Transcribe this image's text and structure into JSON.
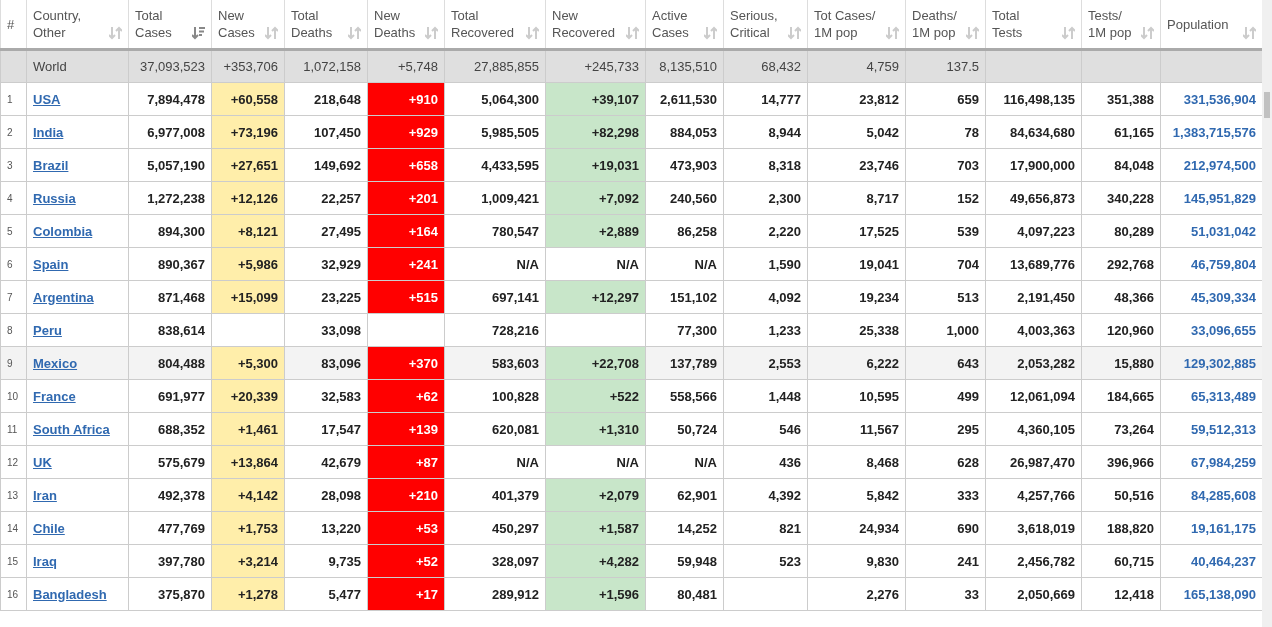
{
  "table": {
    "columns": [
      {
        "kind": "rank",
        "lines": [
          "#"
        ]
      },
      {
        "kind": "link",
        "lines": [
          "Country,",
          "Other"
        ],
        "sorted": false
      },
      {
        "kind": "number",
        "lines": [
          "Total",
          "Cases"
        ],
        "sorted": true
      },
      {
        "kind": "new_cases",
        "lines": [
          "New",
          "Cases"
        ],
        "sorted": false
      },
      {
        "kind": "number",
        "lines": [
          "Total",
          "Deaths"
        ],
        "sorted": false
      },
      {
        "kind": "new_deaths",
        "lines": [
          "New",
          "Deaths"
        ],
        "sorted": false
      },
      {
        "kind": "number",
        "lines": [
          "Total",
          "Recovered"
        ],
        "sorted": false
      },
      {
        "kind": "new_recovered",
        "lines": [
          "New",
          "Recovered"
        ],
        "sorted": false
      },
      {
        "kind": "number",
        "lines": [
          "Active",
          "Cases"
        ],
        "sorted": false
      },
      {
        "kind": "number",
        "lines": [
          "Serious,",
          "Critical"
        ],
        "sorted": false
      },
      {
        "kind": "number",
        "lines": [
          "Tot Cases/",
          "1M pop"
        ],
        "sorted": false
      },
      {
        "kind": "number",
        "lines": [
          "Deaths/",
          "1M pop"
        ],
        "sorted": false
      },
      {
        "kind": "number",
        "lines": [
          "Total",
          "Tests"
        ],
        "sorted": false
      },
      {
        "kind": "number",
        "lines": [
          "Tests/",
          "1M pop"
        ],
        "sorted": false
      },
      {
        "kind": "population",
        "lines": [
          "Population"
        ],
        "sorted": false
      }
    ],
    "world_row": {
      "country": "World",
      "total_cases": "37,093,523",
      "new_cases": "+353,706",
      "total_deaths": "1,072,158",
      "new_deaths": "+5,748",
      "total_recovered": "27,885,855",
      "new_recovered": "+245,733",
      "active_cases": "8,135,510",
      "serious_critical": "68,432",
      "tot_cases_1m": "4,759",
      "deaths_1m": "137.5"
    },
    "rows": [
      {
        "highlighted": false,
        "recovered_reported": true,
        "rank": "1",
        "country": "USA",
        "total_cases": "7,894,478",
        "new_cases": "+60,558",
        "total_deaths": "218,648",
        "new_deaths": "+910",
        "total_recovered": "5,064,300",
        "new_recovered": "+39,107",
        "active_cases": "2,611,530",
        "serious_critical": "14,777",
        "tot_cases_1m": "23,812",
        "deaths_1m": "659",
        "total_tests": "116,498,135",
        "tests_1m": "351,388",
        "population": "331,536,904"
      },
      {
        "highlighted": false,
        "recovered_reported": true,
        "rank": "2",
        "country": "India",
        "total_cases": "6,977,008",
        "new_cases": "+73,196",
        "total_deaths": "107,450",
        "new_deaths": "+929",
        "total_recovered": "5,985,505",
        "new_recovered": "+82,298",
        "active_cases": "884,053",
        "serious_critical": "8,944",
        "tot_cases_1m": "5,042",
        "deaths_1m": "78",
        "total_tests": "84,634,680",
        "tests_1m": "61,165",
        "population": "1,383,715,576"
      },
      {
        "highlighted": false,
        "recovered_reported": true,
        "rank": "3",
        "country": "Brazil",
        "total_cases": "5,057,190",
        "new_cases": "+27,651",
        "total_deaths": "149,692",
        "new_deaths": "+658",
        "total_recovered": "4,433,595",
        "new_recovered": "+19,031",
        "active_cases": "473,903",
        "serious_critical": "8,318",
        "tot_cases_1m": "23,746",
        "deaths_1m": "703",
        "total_tests": "17,900,000",
        "tests_1m": "84,048",
        "population": "212,974,500"
      },
      {
        "highlighted": false,
        "recovered_reported": true,
        "rank": "4",
        "country": "Russia",
        "total_cases": "1,272,238",
        "new_cases": "+12,126",
        "total_deaths": "22,257",
        "new_deaths": "+201",
        "total_recovered": "1,009,421",
        "new_recovered": "+7,092",
        "active_cases": "240,560",
        "serious_critical": "2,300",
        "tot_cases_1m": "8,717",
        "deaths_1m": "152",
        "total_tests": "49,656,873",
        "tests_1m": "340,228",
        "population": "145,951,829"
      },
      {
        "highlighted": false,
        "recovered_reported": true,
        "rank": "5",
        "country": "Colombia",
        "total_cases": "894,300",
        "new_cases": "+8,121",
        "total_deaths": "27,495",
        "new_deaths": "+164",
        "total_recovered": "780,547",
        "new_recovered": "+2,889",
        "active_cases": "86,258",
        "serious_critical": "2,220",
        "tot_cases_1m": "17,525",
        "deaths_1m": "539",
        "total_tests": "4,097,223",
        "tests_1m": "80,289",
        "population": "51,031,042"
      },
      {
        "highlighted": false,
        "recovered_reported": false,
        "rank": "6",
        "country": "Spain",
        "total_cases": "890,367",
        "new_cases": "+5,986",
        "total_deaths": "32,929",
        "new_deaths": "+241",
        "total_recovered": "N/A",
        "new_recovered": "N/A",
        "active_cases": "N/A",
        "serious_critical": "1,590",
        "tot_cases_1m": "19,041",
        "deaths_1m": "704",
        "total_tests": "13,689,776",
        "tests_1m": "292,768",
        "population": "46,759,804"
      },
      {
        "highlighted": false,
        "recovered_reported": true,
        "rank": "7",
        "country": "Argentina",
        "total_cases": "871,468",
        "new_cases": "+15,099",
        "total_deaths": "23,225",
        "new_deaths": "+515",
        "total_recovered": "697,141",
        "new_recovered": "+12,297",
        "active_cases": "151,102",
        "serious_critical": "4,092",
        "tot_cases_1m": "19,234",
        "deaths_1m": "513",
        "total_tests": "2,191,450",
        "tests_1m": "48,366",
        "population": "45,309,334"
      },
      {
        "highlighted": false,
        "recovered_reported": false,
        "rank": "8",
        "country": "Peru",
        "total_cases": "838,614",
        "total_deaths": "33,098",
        "total_recovered": "728,216",
        "active_cases": "77,300",
        "serious_critical": "1,233",
        "tot_cases_1m": "25,338",
        "deaths_1m": "1,000",
        "total_tests": "4,003,363",
        "tests_1m": "120,960",
        "population": "33,096,655"
      },
      {
        "highlighted": true,
        "recovered_reported": true,
        "rank": "9",
        "country": "Mexico",
        "total_cases": "804,488",
        "new_cases": "+5,300",
        "total_deaths": "83,096",
        "new_deaths": "+370",
        "total_recovered": "583,603",
        "new_recovered": "+22,708",
        "active_cases": "137,789",
        "serious_critical": "2,553",
        "tot_cases_1m": "6,222",
        "deaths_1m": "643",
        "total_tests": "2,053,282",
        "tests_1m": "15,880",
        "population": "129,302,885"
      },
      {
        "highlighted": false,
        "recovered_reported": true,
        "rank": "10",
        "country": "France",
        "total_cases": "691,977",
        "new_cases": "+20,339",
        "total_deaths": "32,583",
        "new_deaths": "+62",
        "total_recovered": "100,828",
        "new_recovered": "+522",
        "active_cases": "558,566",
        "serious_critical": "1,448",
        "tot_cases_1m": "10,595",
        "deaths_1m": "499",
        "total_tests": "12,061,094",
        "tests_1m": "184,665",
        "population": "65,313,489"
      },
      {
        "highlighted": false,
        "recovered_reported": true,
        "rank": "11",
        "country": "South Africa",
        "total_cases": "688,352",
        "new_cases": "+1,461",
        "total_deaths": "17,547",
        "new_deaths": "+139",
        "total_recovered": "620,081",
        "new_recovered": "+1,310",
        "active_cases": "50,724",
        "serious_critical": "546",
        "tot_cases_1m": "11,567",
        "deaths_1m": "295",
        "total_tests": "4,360,105",
        "tests_1m": "73,264",
        "population": "59,512,313"
      },
      {
        "highlighted": false,
        "recovered_reported": false,
        "rank": "12",
        "country": "UK",
        "total_cases": "575,679",
        "new_cases": "+13,864",
        "total_deaths": "42,679",
        "new_deaths": "+87",
        "total_recovered": "N/A",
        "new_recovered": "N/A",
        "active_cases": "N/A",
        "serious_critical": "436",
        "tot_cases_1m": "8,468",
        "deaths_1m": "628",
        "total_tests": "26,987,470",
        "tests_1m": "396,966",
        "population": "67,984,259"
      },
      {
        "highlighted": false,
        "recovered_reported": true,
        "rank": "13",
        "country": "Iran",
        "total_cases": "492,378",
        "new_cases": "+4,142",
        "total_deaths": "28,098",
        "new_deaths": "+210",
        "total_recovered": "401,379",
        "new_recovered": "+2,079",
        "active_cases": "62,901",
        "serious_critical": "4,392",
        "tot_cases_1m": "5,842",
        "deaths_1m": "333",
        "total_tests": "4,257,766",
        "tests_1m": "50,516",
        "population": "84,285,608"
      },
      {
        "highlighted": false,
        "recovered_reported": true,
        "rank": "14",
        "country": "Chile",
        "total_cases": "477,769",
        "new_cases": "+1,753",
        "total_deaths": "13,220",
        "new_deaths": "+53",
        "total_recovered": "450,297",
        "new_recovered": "+1,587",
        "active_cases": "14,252",
        "serious_critical": "821",
        "tot_cases_1m": "24,934",
        "deaths_1m": "690",
        "total_tests": "3,618,019",
        "tests_1m": "188,820",
        "population": "19,161,175"
      },
      {
        "highlighted": false,
        "recovered_reported": true,
        "rank": "15",
        "country": "Iraq",
        "total_cases": "397,780",
        "new_cases": "+3,214",
        "total_deaths": "9,735",
        "new_deaths": "+52",
        "total_recovered": "328,097",
        "new_recovered": "+4,282",
        "active_cases": "59,948",
        "serious_critical": "523",
        "tot_cases_1m": "9,830",
        "deaths_1m": "241",
        "total_tests": "2,456,782",
        "tests_1m": "60,715",
        "population": "40,464,237"
      },
      {
        "highlighted": false,
        "recovered_reported": true,
        "rank": "16",
        "country": "Bangladesh",
        "total_cases": "375,870",
        "new_cases": "+1,278",
        "total_deaths": "5,477",
        "new_deaths": "+17",
        "total_recovered": "289,912",
        "new_recovered": "+1,596",
        "active_cases": "80,481",
        "tot_cases_1m": "2,276",
        "deaths_1m": "33",
        "total_tests": "2,050,669",
        "tests_1m": "12,418",
        "population": "165,138,090"
      }
    ]
  }
}
